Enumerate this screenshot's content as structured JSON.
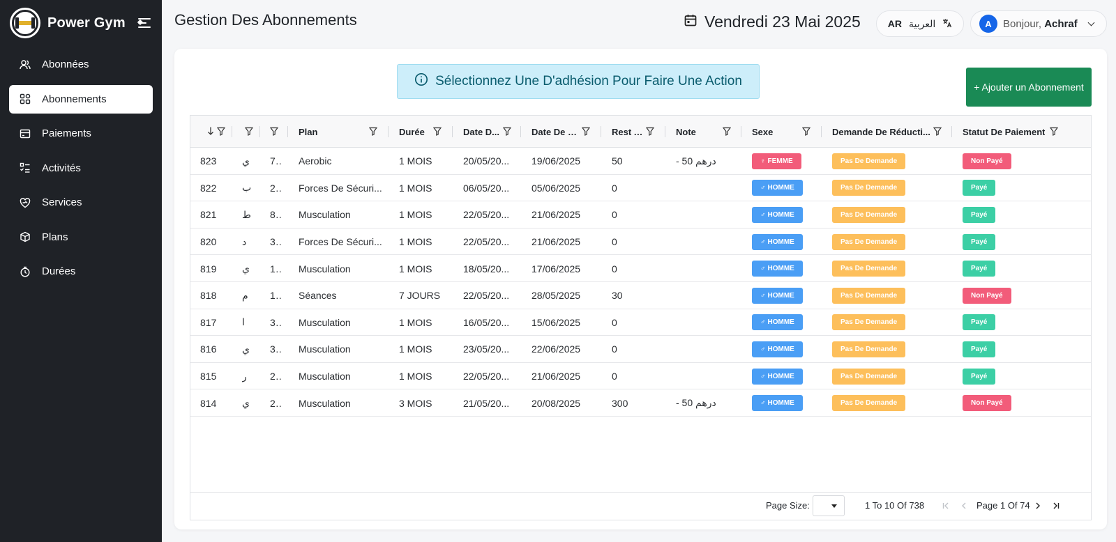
{
  "brand": {
    "name": "Power Gym",
    "logo_text": "POWER GYM"
  },
  "sidebar": {
    "items": [
      {
        "label": "Abonnées",
        "icon": "users-icon",
        "active": false
      },
      {
        "label": "Abonnements",
        "icon": "grid-icon",
        "active": true
      },
      {
        "label": "Paiements",
        "icon": "wallet-icon",
        "active": false
      },
      {
        "label": "Activités",
        "icon": "checklist-icon",
        "active": false
      },
      {
        "label": "Services",
        "icon": "heart-hand-icon",
        "active": false
      },
      {
        "label": "Plans",
        "icon": "box-icon",
        "active": false
      },
      {
        "label": "Durées",
        "icon": "timer-icon",
        "active": false
      }
    ]
  },
  "header": {
    "title": "Gestion Des Abonnements",
    "date": "Vendredi 23 Mai 2025",
    "lang_code": "AR",
    "lang_label": "العربية",
    "greeting": "Bonjour,",
    "user_name": "Achraf",
    "avatar_initial": "A"
  },
  "banner": {
    "text": "Sélectionnez Une D'adhésion Pour Faire Une Action"
  },
  "add_button": {
    "label": "+  Ajouter un Abonnement"
  },
  "table": {
    "columns": [
      {
        "label": "",
        "key": "id"
      },
      {
        "label": "",
        "key": "name"
      },
      {
        "label": "",
        "key": "phone"
      },
      {
        "label": "Plan",
        "key": "plan"
      },
      {
        "label": "Durée",
        "key": "duree"
      },
      {
        "label": "Date D...",
        "key": "date_debut"
      },
      {
        "label": "Date De Fin",
        "key": "date_fin"
      },
      {
        "label": "Rest A...",
        "key": "reste"
      },
      {
        "label": "Note",
        "key": "note"
      },
      {
        "label": "Sexe",
        "key": "sexe"
      },
      {
        "label": "Demande De Réducti...",
        "key": "demande"
      },
      {
        "label": "Statut De Paiement",
        "key": "statut"
      }
    ],
    "rows": [
      {
        "id": "823",
        "name": "ي",
        "phone": "7...",
        "plan": "Aerobic",
        "duree": "1 MOIS",
        "date_debut": "20/05/20...",
        "date_fin": "19/06/2025",
        "reste": "50",
        "note": "- 50 درهم",
        "sexe": "FEMME",
        "demande": "Pas De Demande",
        "statut": "Non Payé"
      },
      {
        "id": "822",
        "name": "ب",
        "phone": "2...",
        "plan": "Forces De Sécuri...",
        "duree": "1 MOIS",
        "date_debut": "06/05/20...",
        "date_fin": "05/06/2025",
        "reste": "0",
        "note": "",
        "sexe": "HOMME",
        "demande": "Pas De Demande",
        "statut": "Payé"
      },
      {
        "id": "821",
        "name": "ط",
        "phone": "8...",
        "plan": "Musculation",
        "duree": "1 MOIS",
        "date_debut": "22/05/20...",
        "date_fin": "21/06/2025",
        "reste": "0",
        "note": "",
        "sexe": "HOMME",
        "demande": "Pas De Demande",
        "statut": "Payé"
      },
      {
        "id": "820",
        "name": "د",
        "phone": "3...",
        "plan": "Forces De Sécuri...",
        "duree": "1 MOIS",
        "date_debut": "22/05/20...",
        "date_fin": "21/06/2025",
        "reste": "0",
        "note": "",
        "sexe": "HOMME",
        "demande": "Pas De Demande",
        "statut": "Payé"
      },
      {
        "id": "819",
        "name": "ي",
        "phone": "1...",
        "plan": "Musculation",
        "duree": "1 MOIS",
        "date_debut": "18/05/20...",
        "date_fin": "17/06/2025",
        "reste": "0",
        "note": "",
        "sexe": "HOMME",
        "demande": "Pas De Demande",
        "statut": "Payé"
      },
      {
        "id": "818",
        "name": "م",
        "phone": "1...",
        "plan": "Séances",
        "duree": "7 JOURS",
        "date_debut": "22/05/20...",
        "date_fin": "28/05/2025",
        "reste": "30",
        "note": "",
        "sexe": "HOMME",
        "demande": "Pas De Demande",
        "statut": "Non Payé"
      },
      {
        "id": "817",
        "name": "ا",
        "phone": "3...",
        "plan": "Musculation",
        "duree": "1 MOIS",
        "date_debut": "16/05/20...",
        "date_fin": "15/06/2025",
        "reste": "0",
        "note": "",
        "sexe": "HOMME",
        "demande": "Pas De Demande",
        "statut": "Payé"
      },
      {
        "id": "816",
        "name": "ي",
        "phone": "3...",
        "plan": "Musculation",
        "duree": "1 MOIS",
        "date_debut": "23/05/20...",
        "date_fin": "22/06/2025",
        "reste": "0",
        "note": "",
        "sexe": "HOMME",
        "demande": "Pas De Demande",
        "statut": "Payé"
      },
      {
        "id": "815",
        "name": "ر",
        "phone": "2...",
        "plan": "Musculation",
        "duree": "1 MOIS",
        "date_debut": "22/05/20...",
        "date_fin": "21/06/2025",
        "reste": "0",
        "note": "",
        "sexe": "HOMME",
        "demande": "Pas De Demande",
        "statut": "Payé"
      },
      {
        "id": "814",
        "name": "ي",
        "phone": "2...",
        "plan": "Musculation",
        "duree": "3 MOIS",
        "date_debut": "21/05/20...",
        "date_fin": "20/08/2025",
        "reste": "300",
        "note": "- 50 درهم",
        "sexe": "HOMME",
        "demande": "Pas De Demande",
        "statut": "Non Payé"
      }
    ]
  },
  "pagination": {
    "page_size_label": "Page Size:",
    "range": "1 To 10 Of 738",
    "page_text": "Page 1 Of 74"
  },
  "colors": {
    "sidebar_bg": "#1f2227",
    "accent_green": "#1a8a55",
    "badge_femme": "#f25c7a",
    "badge_homme": "#4a9ef5",
    "badge_demande": "#fdbf5b",
    "badge_paye": "#3ccfa5",
    "badge_non_paye": "#f25c7a"
  }
}
